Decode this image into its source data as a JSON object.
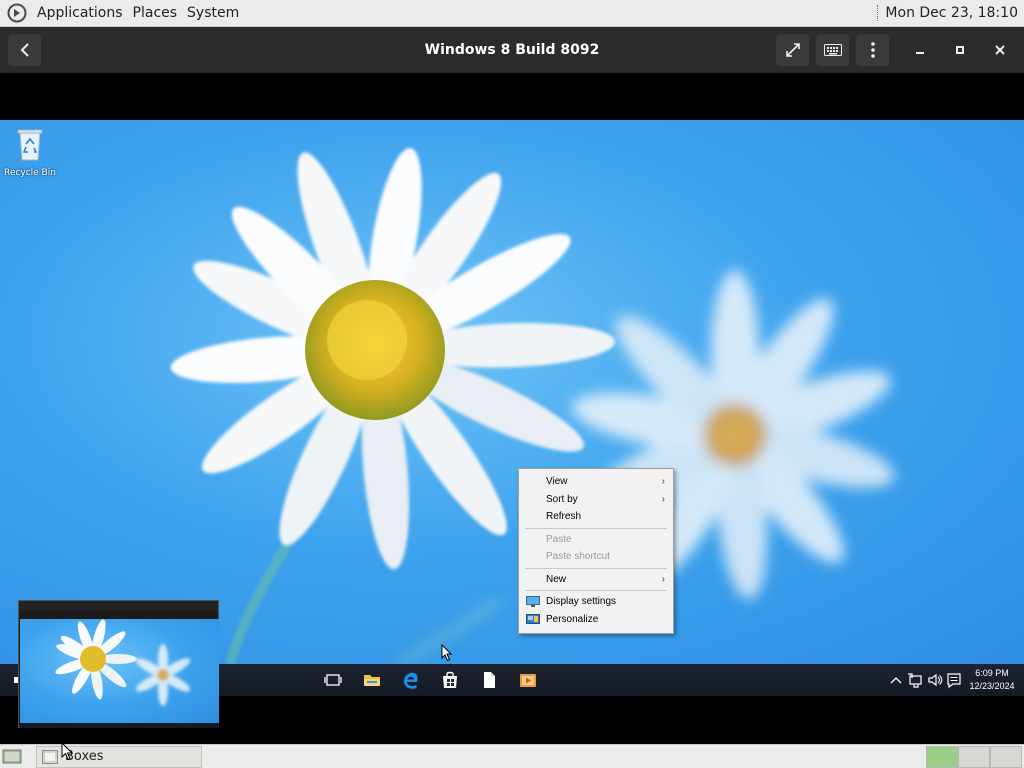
{
  "top_panel": {
    "menus": [
      "Applications",
      "Places",
      "System"
    ],
    "clock": "Mon Dec 23, 18:10"
  },
  "boxes": {
    "title": "Windows 8 Build 8092"
  },
  "desktop": {
    "recycle_bin_label": "Recycle Bin"
  },
  "context_menu": {
    "view": "View",
    "sort_by": "Sort by",
    "refresh": "Refresh",
    "paste": "Paste",
    "paste_shortcut": "Paste shortcut",
    "new": "New",
    "display_settings": "Display settings",
    "personalize": "Personalize"
  },
  "taskbar": {
    "time": "6:09 PM",
    "date": "12/23/2024"
  },
  "bottom_panel": {
    "task_label": "Boxes"
  },
  "colors": {
    "sky": "#3ea3ee",
    "panel": "#ebecea",
    "header": "#2b2b2b"
  }
}
